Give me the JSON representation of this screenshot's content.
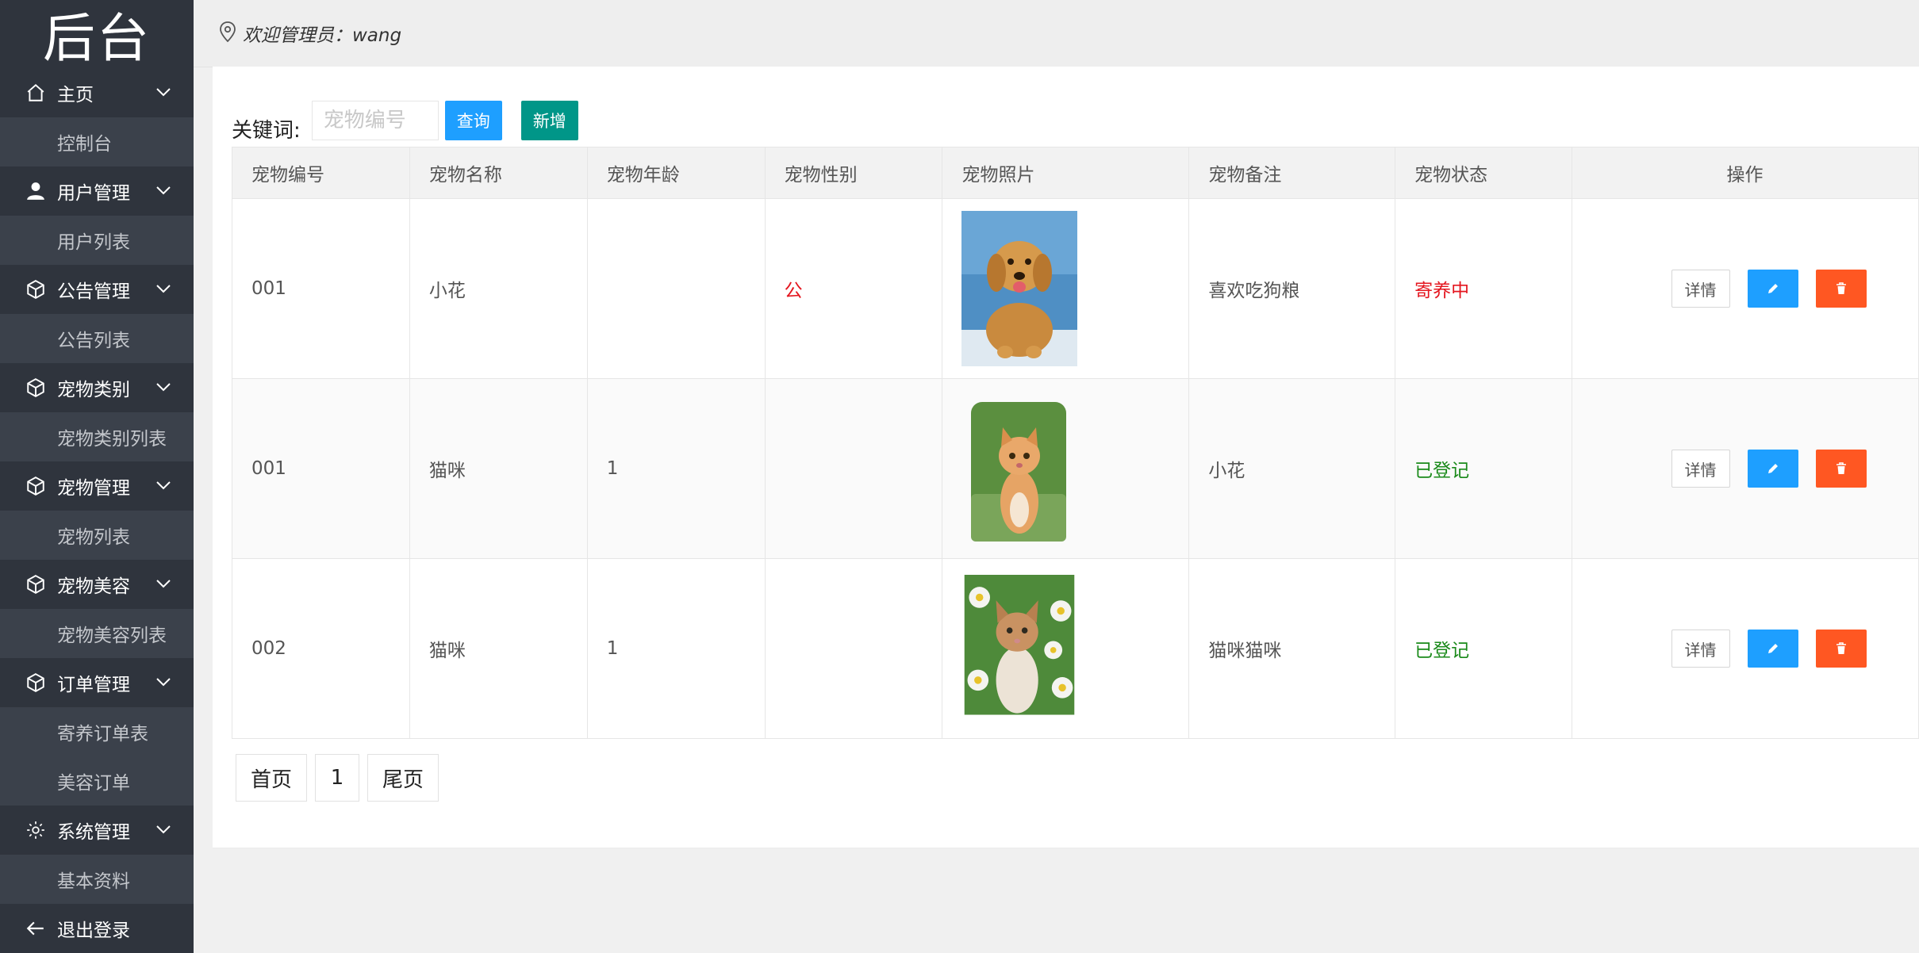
{
  "sidebar": {
    "logo": "后台",
    "groups": [
      {
        "label": "主页",
        "icon": "home-icon",
        "items": [
          "控制台"
        ]
      },
      {
        "label": "用户管理",
        "icon": "user-icon",
        "items": [
          "用户列表"
        ]
      },
      {
        "label": "公告管理",
        "icon": "cube-icon",
        "items": [
          "公告列表"
        ]
      },
      {
        "label": "宠物类别",
        "icon": "cube-icon",
        "items": [
          "宠物类别列表"
        ]
      },
      {
        "label": "宠物管理",
        "icon": "cube-icon",
        "items": [
          "宠物列表"
        ]
      },
      {
        "label": "宠物美容",
        "icon": "cube-icon",
        "items": [
          "宠物美容列表"
        ]
      },
      {
        "label": "订单管理",
        "icon": "cube-icon",
        "items": [
          "寄养订单表",
          "美容订单"
        ]
      },
      {
        "label": "系统管理",
        "icon": "gear-icon",
        "items": [
          "基本资料"
        ]
      }
    ],
    "logout": "退出登录"
  },
  "header": {
    "welcome": "欢迎管理员：wang"
  },
  "toolbar": {
    "keyword_label": "关键词:",
    "search_placeholder": "宠物编号",
    "query_label": "查询",
    "add_label": "新增"
  },
  "table": {
    "columns": [
      "宠物编号",
      "宠物名称",
      "宠物年龄",
      "宠物性别",
      "宠物照片",
      "宠物备注",
      "宠物状态",
      "操作"
    ],
    "rows": [
      {
        "id": "001",
        "name": "小花",
        "age": "",
        "gender": "公",
        "photo": "golden-retriever-puppy",
        "remark": "喜欢吃狗粮",
        "status": "寄养中"
      },
      {
        "id": "001",
        "name": "猫咪",
        "age": "1",
        "gender": "",
        "photo": "orange-kitten",
        "remark": "小花",
        "status": "已登记"
      },
      {
        "id": "002",
        "name": "猫咪",
        "age": "1",
        "gender": "",
        "photo": "kitten-daisies",
        "remark": "猫咪猫咪",
        "status": "已登记"
      }
    ],
    "detail_label": "详情"
  },
  "pager": {
    "first": "首页",
    "current": "1",
    "last": "尾页"
  },
  "colors": {
    "sidebar_bg": "#2f343d",
    "sidebar_sub_bg": "#3b414b",
    "primary": "#1e9fff",
    "success": "#009688",
    "danger": "#ff5722",
    "status_red": "#e4161f",
    "status_green": "#1a8a1a"
  }
}
